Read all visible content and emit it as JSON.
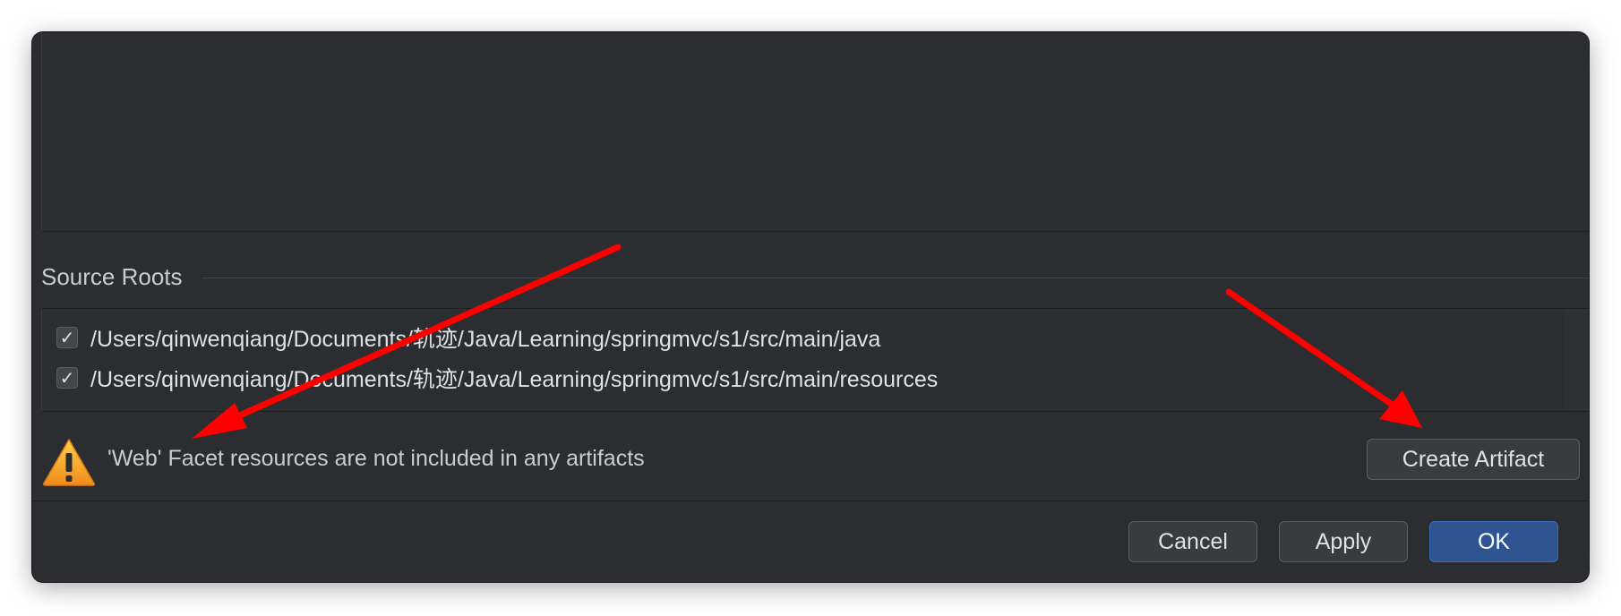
{
  "section": {
    "title": "Source Roots"
  },
  "source_roots": [
    {
      "checked": true,
      "path": "/Users/qinwenqiang/Documents/轨迹/Java/Learning/springmvc/s1/src/main/java"
    },
    {
      "checked": true,
      "path": "/Users/qinwenqiang/Documents/轨迹/Java/Learning/springmvc/s1/src/main/resources"
    }
  ],
  "warning": {
    "icon": "warning-icon",
    "text": "'Web' Facet resources are not included in any artifacts",
    "action_label": "Create Artifact"
  },
  "footer": {
    "cancel_label": "Cancel",
    "apply_label": "Apply",
    "ok_label": "OK"
  },
  "colors": {
    "dialog_bg": "#2b2d30",
    "primary_button": "#2e5492",
    "annotation_arrow": "#ff0000",
    "warning_icon": "#f5a623"
  }
}
